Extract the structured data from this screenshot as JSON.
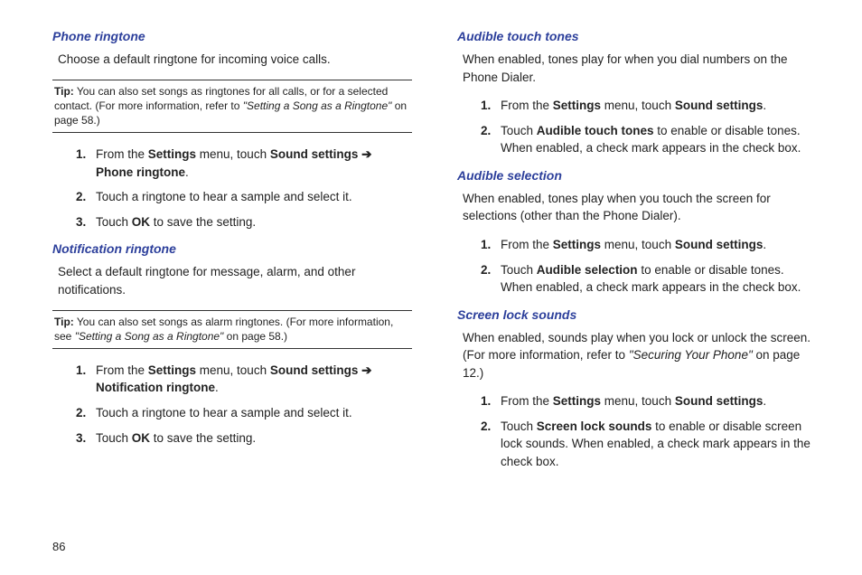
{
  "page_number": "86",
  "left": {
    "phone_ringtone": {
      "heading": "Phone ringtone",
      "intro": "Choose a default ringtone for incoming voice calls.",
      "tip_label": "Tip:",
      "tip_text_1": " You can also set songs as ringtones for all calls, or for a selected contact. (For more information, refer to ",
      "tip_ref": "\"Setting a Song as a Ringtone\"",
      "tip_text_2": " on page 58.)",
      "steps": {
        "1": {
          "n": "1.",
          "pre": "From the ",
          "b1": "Settings",
          "mid": " menu, touch ",
          "b2": "Sound settings",
          "arrow": " ➔ ",
          "b3": "Phone ringtone",
          "post": "."
        },
        "2": {
          "n": "2.",
          "t": "Touch a ringtone to hear a sample and select it."
        },
        "3": {
          "n": "3.",
          "pre": "Touch ",
          "b1": "OK",
          "post": " to save the setting."
        }
      }
    },
    "notification_ringtone": {
      "heading": "Notification ringtone",
      "intro": "Select a default ringtone for message, alarm, and other notifications.",
      "tip_label": "Tip:",
      "tip_text_1": " You can also set songs as alarm ringtones. (For more information, see ",
      "tip_ref": "\"Setting a Song as a Ringtone\"",
      "tip_text_2": " on page 58.)",
      "steps": {
        "1": {
          "n": "1.",
          "pre": "From the ",
          "b1": "Settings",
          "mid": " menu, touch ",
          "b2": "Sound settings",
          "arrow": " ➔ ",
          "b3": "Notification ringtone",
          "post": "."
        },
        "2": {
          "n": "2.",
          "t": "Touch a ringtone to hear a sample and select it."
        },
        "3": {
          "n": "3.",
          "pre": "Touch ",
          "b1": "OK",
          "post": " to save the setting."
        }
      }
    }
  },
  "right": {
    "audible_touch": {
      "heading": "Audible touch tones",
      "intro": "When enabled, tones play for when you dial numbers on the Phone Dialer.",
      "steps": {
        "1": {
          "n": "1.",
          "pre": "From the ",
          "b1": "Settings",
          "mid": " menu, touch ",
          "b2": "Sound settings",
          "post": "."
        },
        "2": {
          "n": "2.",
          "pre": "Touch ",
          "b1": "Audible touch tones",
          "post": " to enable or disable tones. When enabled, a check mark appears in the check box."
        }
      }
    },
    "audible_selection": {
      "heading": "Audible selection",
      "intro": "When enabled, tones play when you touch the screen for selections (other than the Phone Dialer).",
      "steps": {
        "1": {
          "n": "1.",
          "pre": "From the ",
          "b1": "Settings",
          "mid": " menu, touch ",
          "b2": "Sound settings",
          "post": "."
        },
        "2": {
          "n": "2.",
          "pre": "Touch ",
          "b1": "Audible selection",
          "post": " to enable or disable tones. When enabled, a check mark appears in the check box."
        }
      }
    },
    "screen_lock": {
      "heading": "Screen lock sounds",
      "intro_1": "When enabled, sounds play when you lock or unlock the screen. (For more information, refer to ",
      "intro_ref": "\"Securing Your Phone\"",
      "intro_2": " on page 12.)",
      "steps": {
        "1": {
          "n": "1.",
          "pre": "From the ",
          "b1": "Settings",
          "mid": " menu, touch ",
          "b2": "Sound settings",
          "post": "."
        },
        "2": {
          "n": "2.",
          "pre": "Touch ",
          "b1": "Screen lock sounds",
          "post": " to enable or disable screen lock sounds. When enabled, a check mark appears in the check box."
        }
      }
    }
  }
}
